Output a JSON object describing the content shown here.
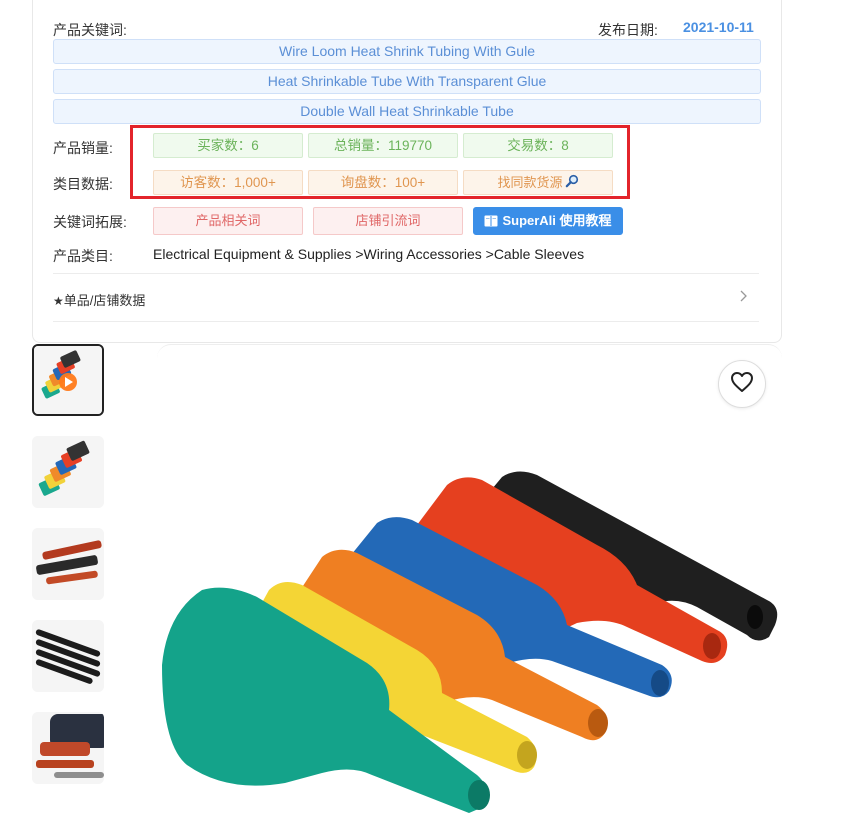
{
  "header": {
    "keywords_label": "产品关键词:",
    "date_label": "发布日期:",
    "date_value": "2021-10-11"
  },
  "keywords": [
    "Wire Loom Heat Shrink Tubing With Gule",
    "Heat Shrinkable Tube With Transparent Glue",
    "Double Wall Heat Shrinkable Tube"
  ],
  "sales": {
    "label": "产品销量:",
    "buyers": "买家数：6",
    "total_sales": "总销量：119770",
    "transactions": "交易数：8"
  },
  "category_data": {
    "label": "类目数据:",
    "visitors": "访客数：1,000+",
    "inquiries": "询盘数：100+",
    "find_same": "找同款货源"
  },
  "keyword_expand": {
    "label": "关键词拓展:",
    "related": "产品相关词",
    "store_traffic": "店铺引流词",
    "tutorial": "SuperAli 使用教程"
  },
  "category": {
    "label": "产品类目:",
    "path": "Electrical Equipment & Supplies >Wiring Accessories >Cable Sleeves"
  },
  "store_data": {
    "star": "★",
    "label": "单品/店铺数据"
  },
  "colors": {
    "accent_blue": "#3a8ee8",
    "highlight_red": "#e3242b"
  },
  "gallery": {
    "thumbnail_count": 5,
    "active_index": 0
  }
}
